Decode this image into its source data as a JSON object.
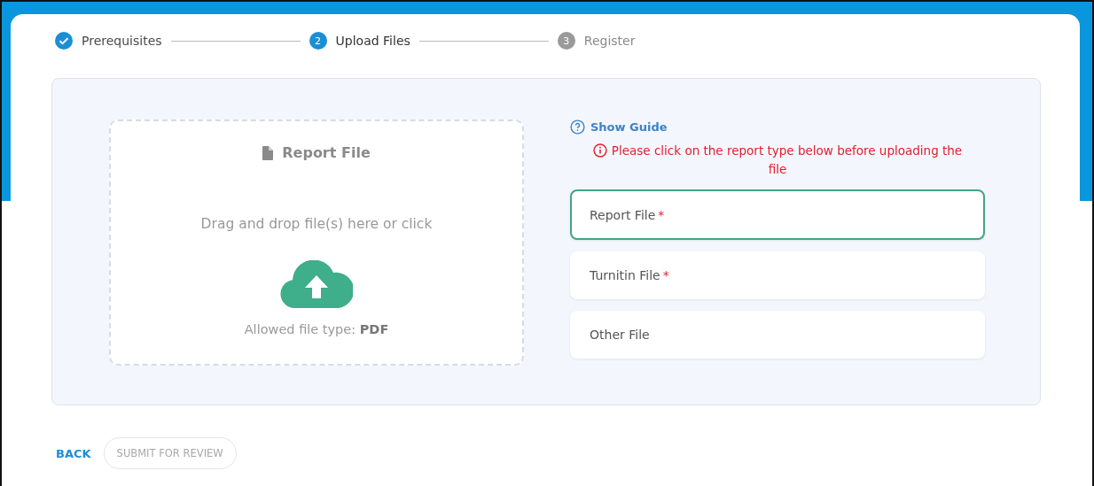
{
  "steps": [
    {
      "label": "Prerequisites",
      "completed": true,
      "selected": false
    },
    {
      "number": "2",
      "label": "Upload Files",
      "completed": false,
      "selected": true
    },
    {
      "number": "3",
      "label": "Register",
      "completed": false,
      "selected": false
    }
  ],
  "dropzone": {
    "title": "Report File",
    "instruction": "Drag and drop file(s) here or click",
    "allowed": "Allowed file type: **PDF**"
  },
  "guide_link": "Show Guide",
  "warning": "Please click on the report type below before uploading the file",
  "file_types": [
    {
      "label": "Report File",
      "required": true,
      "selected": true
    },
    {
      "label": "Turnitin File",
      "required": true,
      "selected": false
    },
    {
      "label": "Other File",
      "required": false,
      "selected": false
    }
  ],
  "required_mark": "*",
  "buttons": [
    {
      "label": "BACK",
      "kind": "text",
      "disabled": false
    },
    {
      "label": "SUBMIT FOR REVIEW",
      "kind": "outlined",
      "disabled": true
    }
  ]
}
